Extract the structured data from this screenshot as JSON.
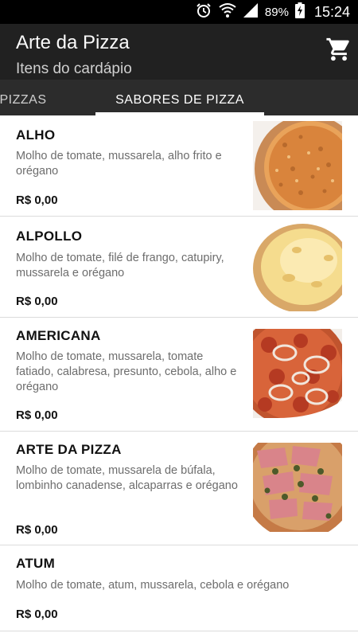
{
  "status_bar": {
    "battery_percent": "89%",
    "time": "15:24",
    "icons": [
      "alarm-icon",
      "wifi-icon",
      "signal-icon",
      "battery-charging-icon"
    ]
  },
  "app_bar": {
    "title": "Arte da Pizza",
    "subtitle": "Itens do cardápio",
    "cart_icon": "shopping-cart-icon"
  },
  "tabs": [
    {
      "label": "PIZZAS",
      "selected": false
    },
    {
      "label": "SABORES DE PIZZA",
      "selected": true
    }
  ],
  "colors": {
    "status_bar": "#000000",
    "app_bar": "#212121",
    "tab_bar": "#2c2c2c",
    "tab_indicator": "#ffffff",
    "description_text": "#6d6d6d"
  },
  "items": [
    {
      "name": "ALHO",
      "description": "Molho de tomate, mussarela, alho frito e orégano",
      "price": "R$ 0,00",
      "image": "pizza-alho-photo"
    },
    {
      "name": "ALPOLLO",
      "description": "Molho de tomate, filé de frango, catupiry, mussarela e orégano",
      "price": "R$ 0,00",
      "image": "pizza-alpollo-photo"
    },
    {
      "name": "AMERICANA",
      "description": "Molho de tomate, mussarela, tomate fatiado, calabresa, presunto, cebola, alho e orégano",
      "price": "R$ 0,00",
      "image": "pizza-americana-photo"
    },
    {
      "name": "ARTE DA PIZZA",
      "description": "Molho de tomate, mussarela de búfala, lombinho canadense, alcaparras e orégano",
      "price": "R$ 0,00",
      "image": "pizza-arte-da-pizza-photo"
    },
    {
      "name": "ATUM",
      "description": "Molho de tomate, atum, mussarela, cebola e orégano",
      "price": "R$ 0,00",
      "image": null
    }
  ]
}
